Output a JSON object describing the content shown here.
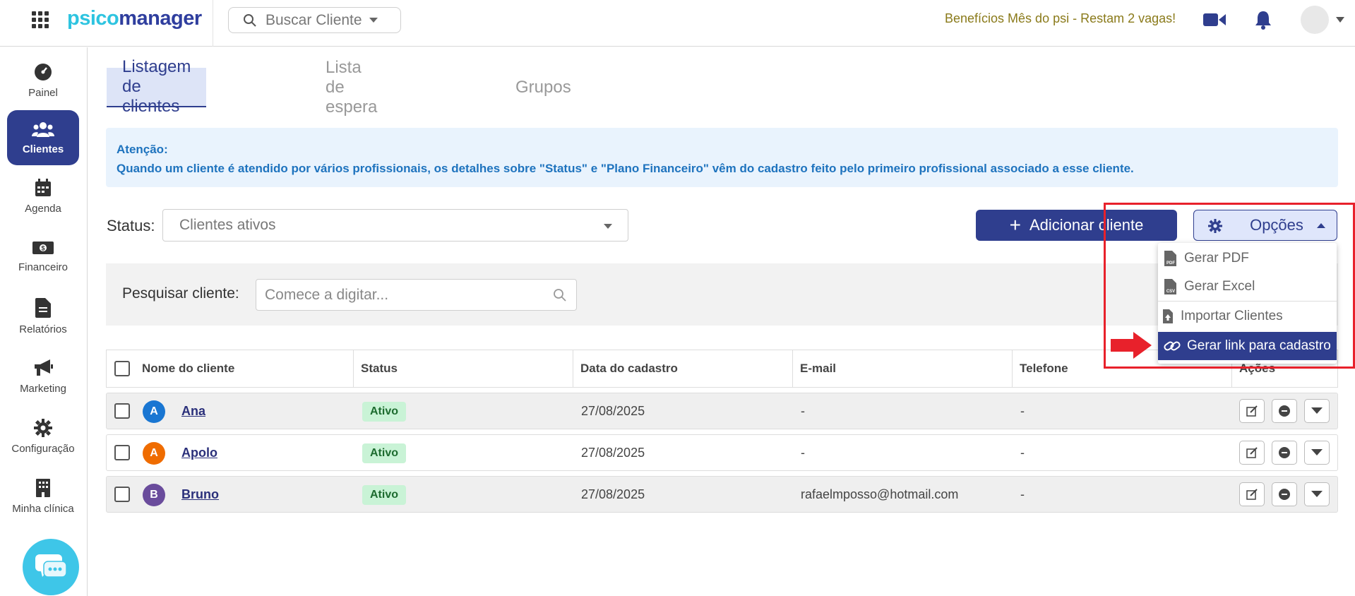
{
  "app": {
    "logo_part1": "psico",
    "logo_part2": "manager",
    "search_client_label": "Buscar Cliente",
    "promo_text": "Benefícios Mês do psi - Restam 2 vagas!"
  },
  "sidebar": {
    "items": [
      {
        "label": "Painel",
        "icon": "dashboard-icon"
      },
      {
        "label": "Clientes",
        "icon": "users-icon",
        "active": true
      },
      {
        "label": "Agenda",
        "icon": "calendar-icon"
      },
      {
        "label": "Financeiro",
        "icon": "money-icon"
      },
      {
        "label": "Relatórios",
        "icon": "report-icon"
      },
      {
        "label": "Marketing",
        "icon": "megaphone-icon"
      },
      {
        "label": "Configuração",
        "icon": "gear-icon"
      },
      {
        "label": "Minha clínica",
        "icon": "building-icon"
      }
    ]
  },
  "tabs": [
    {
      "label": "Listagem de clientes",
      "active": true
    },
    {
      "label": "Lista de espera",
      "active": false
    },
    {
      "label": "Grupos",
      "active": false
    }
  ],
  "alert": {
    "title": "Atenção:",
    "message": "Quando um cliente é atendido por vários profissionais, os detalhes sobre \"Status\" e \"Plano Financeiro\" vêm do cadastro feito pelo primeiro profissional associado a esse cliente."
  },
  "filters": {
    "status_label": "Status:",
    "status_value": "Clientes ativos",
    "search_label": "Pesquisar cliente:",
    "search_placeholder": "Comece a digitar..."
  },
  "actions": {
    "add_client_label": "Adicionar cliente",
    "options_label": "Opções"
  },
  "options_menu": {
    "items": [
      {
        "label": "Gerar PDF",
        "icon": "pdf-file-icon"
      },
      {
        "label": "Gerar Excel",
        "icon": "csv-file-icon"
      },
      {
        "label": "Importar Clientes",
        "icon": "upload-file-icon"
      },
      {
        "label": "Gerar link para cadastro",
        "icon": "link-icon",
        "highlighted": true
      }
    ]
  },
  "table": {
    "headers": [
      "Nome do cliente",
      "Status",
      "Data do cadastro",
      "E-mail",
      "Telefone",
      "Ações"
    ],
    "rows": [
      {
        "initial": "A",
        "avatar_color": "#1976d2",
        "name": "Ana",
        "status": "Ativo",
        "date": "27/08/2025",
        "email": "-",
        "phone": "-"
      },
      {
        "initial": "A",
        "avatar_color": "#ef6c00",
        "name": "Apolo",
        "status": "Ativo",
        "date": "27/08/2025",
        "email": "-",
        "phone": "-"
      },
      {
        "initial": "B",
        "avatar_color": "#6a4c9c",
        "name": "Bruno",
        "status": "Ativo",
        "date": "27/08/2025",
        "email": "rafaelmposso@hotmail.com",
        "phone": "-"
      }
    ]
  },
  "colors": {
    "primary": "#2f3e8e",
    "accent": "#2ec4e0",
    "alert_text": "#1e73be",
    "highlight_annotation": "#e8212b"
  }
}
